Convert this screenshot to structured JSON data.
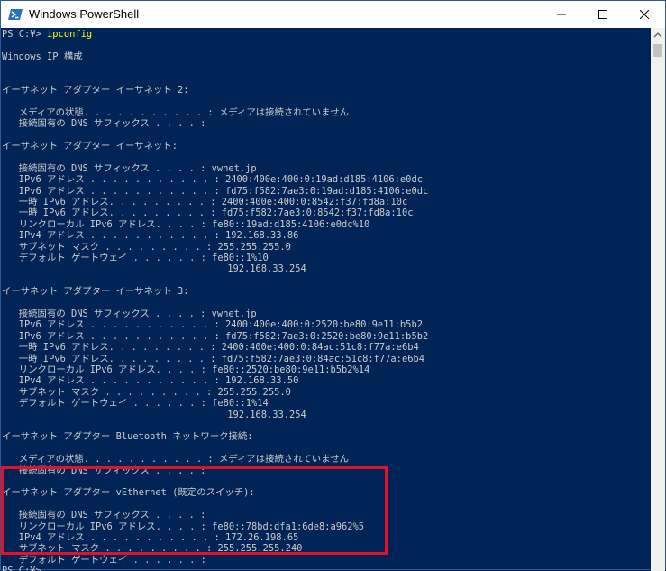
{
  "window": {
    "title": "Windows PowerShell"
  },
  "console": {
    "prompt": "PS C:¥> ",
    "command": "ipconfig",
    "lines": [
      "",
      "Windows IP 構成",
      "",
      "",
      "イーサネット アダプター イーサネット 2:",
      "",
      "   メディアの状態. . . . . . . . . . . : メディアは接続されていません",
      "   接続固有の DNS サフィックス . . . . :",
      "",
      "イーサネット アダプター イーサネット:",
      "",
      "   接続固有の DNS サフィックス . . . . : vwnet.jp",
      "   IPv6 アドレス . . . . . . . . . . . : 2400:400e:400:0:19ad:d185:4106:e0dc",
      "   IPv6 アドレス . . . . . . . . . . . : fd75:f582:7ae3:0:19ad:d185:4106:e0dc",
      "   一時 IPv6 アドレス. . . . . . . . . : 2400:400e:400:0:8542:f37:fd8a:10c",
      "   一時 IPv6 アドレス. . . . . . . . . : fd75:f582:7ae3:0:8542:f37:fd8a:10c",
      "   リンクローカル IPv6 アドレス. . . . : fe80::19ad:d185:4106:e0dc%10",
      "   IPv4 アドレス . . . . . . . . . . . : 192.168.33.86",
      "   サブネット マスク . . . . . . . . . : 255.255.255.0",
      "   デフォルト ゲートウェイ . . . . . . : fe80::1%10",
      "                                        192.168.33.254",
      "",
      "イーサネット アダプター イーサネット 3:",
      "",
      "   接続固有の DNS サフィックス . . . . : vwnet.jp",
      "   IPv6 アドレス . . . . . . . . . . . : 2400:400e:400:0:2520:be80:9e11:b5b2",
      "   IPv6 アドレス . . . . . . . . . . . : fd75:f582:7ae3:0:2520:be80:9e11:b5b2",
      "   一時 IPv6 アドレス. . . . . . . . . : 2400:400e:400:0:84ac:51c8:f77a:e6b4",
      "   一時 IPv6 アドレス. . . . . . . . . : fd75:f582:7ae3:0:84ac:51c8:f77a:e6b4",
      "   リンクローカル IPv6 アドレス. . . . : fe80::2520:be80:9e11:b5b2%14",
      "   IPv4 アドレス . . . . . . . . . . . : 192.168.33.50",
      "   サブネット マスク . . . . . . . . . : 255.255.255.0",
      "   デフォルト ゲートウェイ . . . . . . : fe80::1%14",
      "                                        192.168.33.254",
      "",
      "イーサネット アダプター Bluetooth ネットワーク接続:",
      "",
      "   メディアの状態. . . . . . . . . . . : メディアは接続されていません",
      "   接続固有の DNS サフィックス . . . . :",
      "",
      "イーサネット アダプター vEthernet (既定のスイッチ):",
      "",
      "   接続固有の DNS サフィックス . . . . :",
      "   リンクローカル IPv6 アドレス. . . . : fe80::78bd:dfa1:6de8:a962%5",
      "   IPv4 アドレス . . . . . . . . . . . : 172.26.198.65",
      "   サブネット マスク . . . . . . . . . : 255.255.255.240",
      "   デフォルト ゲートウェイ . . . . . . :",
      "PS C:¥>"
    ]
  },
  "colors": {
    "background": "#012456",
    "text": "#cccccc",
    "command": "#ffff00",
    "highlight": "#e81123"
  },
  "icons": {
    "app": "powershell-icon",
    "minimize": "minimize-icon",
    "maximize": "maximize-icon",
    "close": "close-icon",
    "scroll_up": "scroll-up-arrow-icon"
  }
}
